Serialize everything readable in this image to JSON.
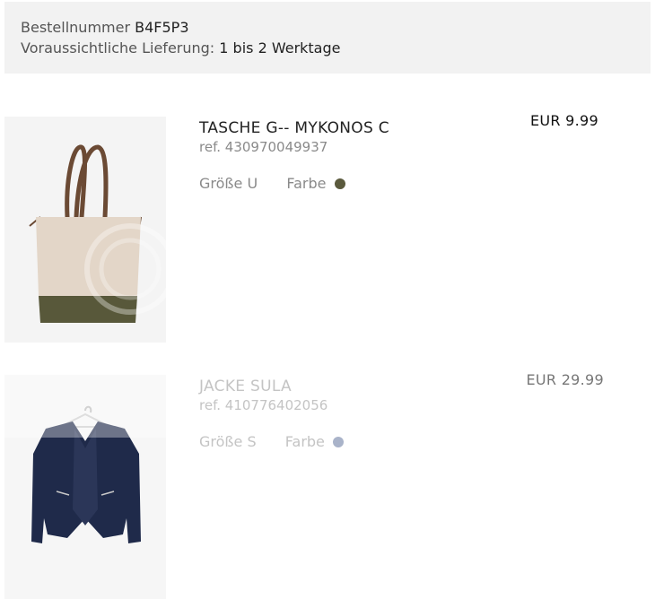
{
  "order": {
    "number_label": "Bestellnummer",
    "number_value": "B4F5P3",
    "delivery_label": "Voraussichtliche Lieferung:",
    "delivery_value": "1 bis 2 Werktage"
  },
  "items": [
    {
      "name": "TASCHE G-- MYKONOS C",
      "ref": "ref. 430970049937",
      "size_label": "Größe",
      "size_value": "U",
      "color_label": "Farbe",
      "color_swatch": "#5b5a3d",
      "price": "EUR 9.99",
      "image_icon": "tote-bag-icon"
    },
    {
      "name": "JACKE SULA",
      "ref": "ref. 410776402056",
      "size_label": "Größe",
      "size_value": "S",
      "color_label": "Farbe",
      "color_swatch": "#a9b3c9",
      "price": "EUR 29.99",
      "image_icon": "jacket-icon"
    }
  ]
}
